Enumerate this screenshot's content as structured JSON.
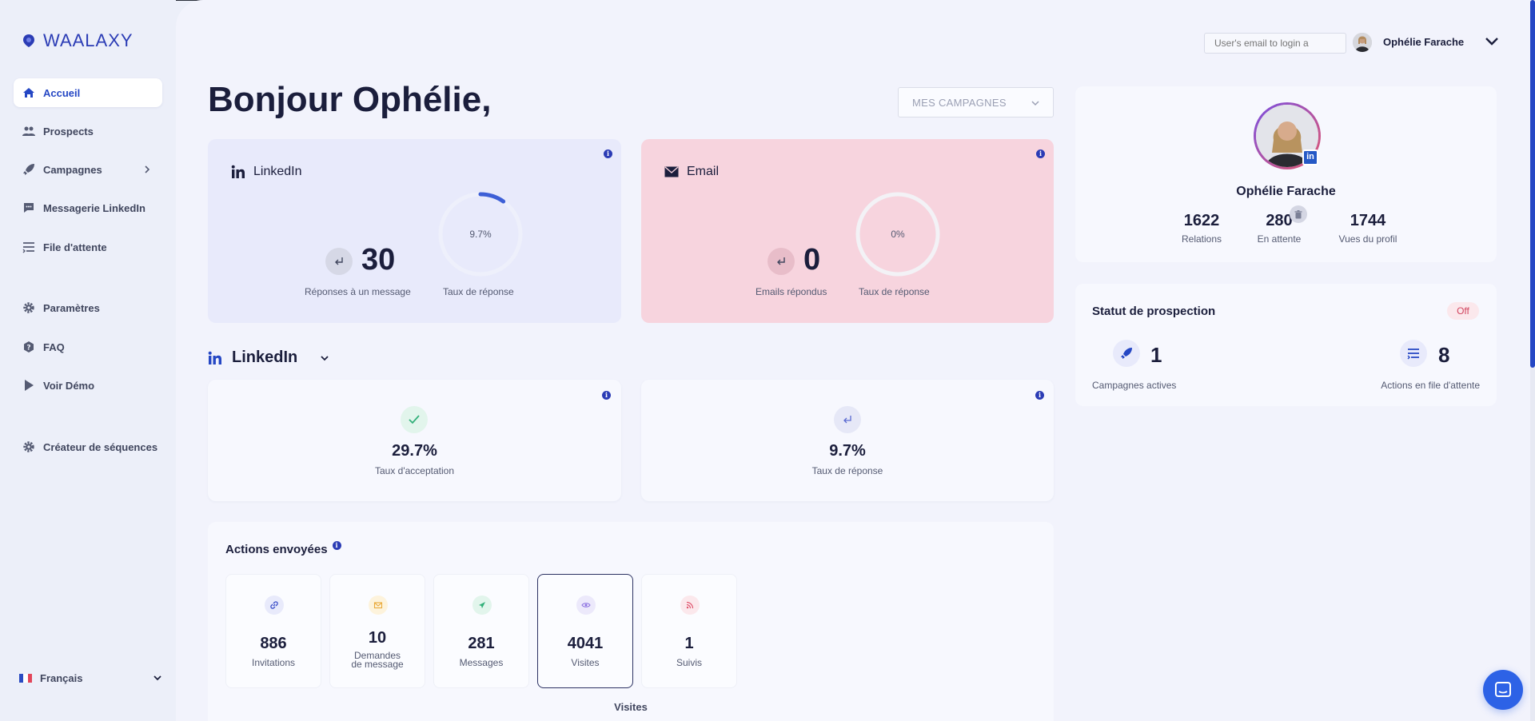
{
  "brand": {
    "name": "WAALAXY",
    "color": "#2b3cb5"
  },
  "sidebar": {
    "items": [
      {
        "label": "Accueil",
        "icon": "home-icon",
        "active": true
      },
      {
        "label": "Prospects",
        "icon": "users-icon"
      },
      {
        "label": "Campagnes",
        "icon": "rocket-icon"
      },
      {
        "label": "Messagerie LinkedIn",
        "icon": "chat-icon"
      },
      {
        "label": "File d'attente",
        "icon": "queue-icon"
      },
      {
        "label": "Paramètres",
        "icon": "gear-icon"
      },
      {
        "label": "FAQ",
        "icon": "question-icon"
      },
      {
        "label": "Voir Démo",
        "icon": "play-icon"
      },
      {
        "label": "Créateur de séquences",
        "icon": "gear-icon"
      }
    ],
    "language": "Français"
  },
  "header": {
    "email_placeholder": "User's email to login a",
    "user_name": "Ophélie Farache"
  },
  "main": {
    "greeting": "Bonjour Ophélie,",
    "campaign_select": "MES CAMPAGNES",
    "linkedin_card": {
      "title": "LinkedIn",
      "value": "30",
      "value_label": "Réponses à un message",
      "gauge_text": "9.7%",
      "gauge_fraction": 0.097,
      "gauge_label": "Taux de réponse"
    },
    "email_card": {
      "title": "Email",
      "value": "0",
      "value_label": "Emails répondus",
      "gauge_text": "0%",
      "gauge_fraction": 0,
      "gauge_label": "Taux de réponse"
    },
    "section": {
      "title": "LinkedIn"
    },
    "acceptance": {
      "value": "29.7%",
      "label": "Taux d'acceptation"
    },
    "reply_rate": {
      "value": "9.7%",
      "label": "Taux de réponse"
    },
    "actions": {
      "title": "Actions envoyées",
      "tiles": [
        {
          "value": "886",
          "label": "Invitations",
          "icon": "link-icon"
        },
        {
          "value": "10",
          "label_line1": "Demandes",
          "label_line2": "de message",
          "icon": "envelope-icon"
        },
        {
          "value": "281",
          "label": "Messages",
          "icon": "send-icon"
        },
        {
          "value": "4041",
          "label": "Visites",
          "icon": "eye-icon",
          "selected": true
        },
        {
          "value": "1",
          "label": "Suivis",
          "icon": "rss-icon"
        }
      ],
      "selected_label": "Visites"
    }
  },
  "profile": {
    "name": "Ophélie Farache",
    "relations": "1622",
    "relations_label": "Relations",
    "pending": "280",
    "pending_label": "En attente",
    "views": "1744",
    "views_label": "Vues du profil"
  },
  "status": {
    "title": "Statut de prospection",
    "badge": "Off",
    "active_campaigns": "1",
    "active_campaigns_label": "Campagnes actives",
    "queued_actions": "8",
    "queued_actions_label": "Actions en file d'attente"
  },
  "colors": {
    "accent": "#2547c4",
    "linkedin_card_bg": "#e8eafb",
    "email_card_bg": "#f7d4de",
    "off_badge": "#d1455f"
  }
}
